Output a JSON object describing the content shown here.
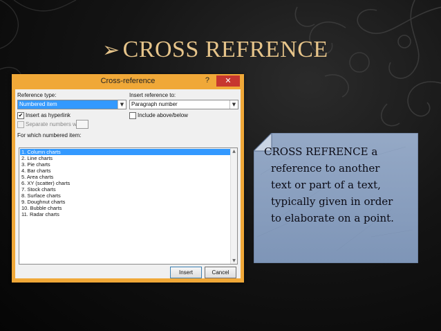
{
  "slide": {
    "title": "CROSS REFRENCE",
    "title_bullet": "➢",
    "title_color": "#e6c48a",
    "body_lines": [
      "CROSS REFRENCE a",
      "reference to another",
      "text or part of a text,",
      "typically given in order",
      "to elaborate on a point."
    ]
  },
  "dialog": {
    "title": "Cross-reference",
    "help_label": "?",
    "close_label": "✕",
    "frame_color": "#f0a838",
    "reference_type_label": "Reference type:",
    "reference_type_value": "Numbered item",
    "insert_reference_label": "Insert reference to:",
    "insert_reference_value": "Paragraph number",
    "insert_hyperlink_label": "Insert as hyperlink",
    "insert_hyperlink_checked": true,
    "include_above_below_label": "Include above/below",
    "include_above_below_checked": false,
    "separate_numbers_label": "Separate numbers with",
    "for_which_label": "For which numbered item:",
    "items": [
      "1. Column charts",
      "2. Line charts",
      "3. Pie charts",
      "4. Bar charts",
      "5. Area charts",
      "6. XY (scatter) charts",
      "7. Stock charts",
      "8. Surface charts",
      "9. Doughnut charts",
      "10. Bubble charts",
      "11. Radar charts"
    ],
    "selected_item": "1. Column charts",
    "insert_button": "Insert",
    "cancel_button": "Cancel"
  }
}
